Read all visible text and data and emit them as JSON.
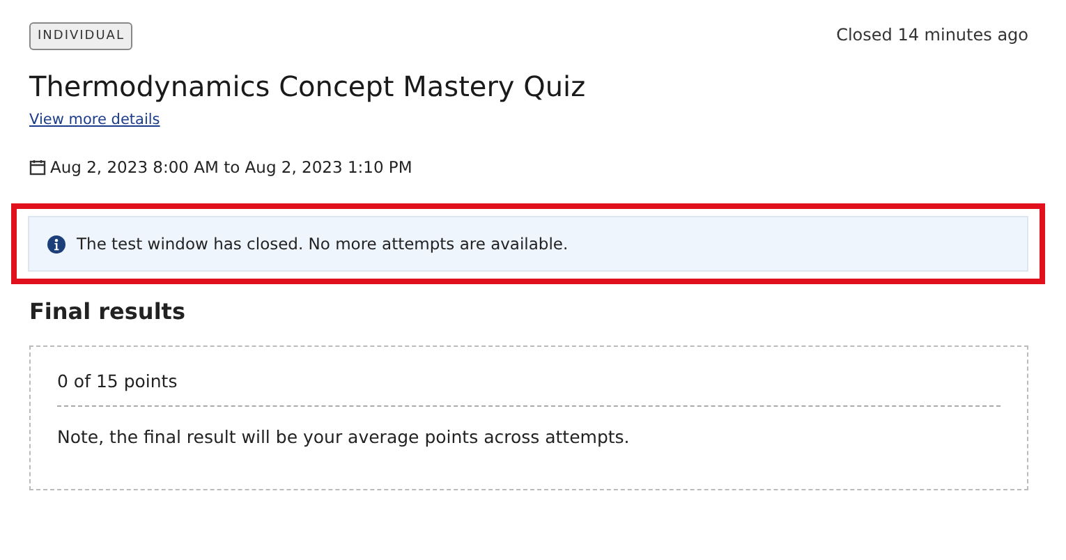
{
  "badge": "INDIVIDUAL",
  "status": "Closed 14 minutes ago",
  "title": "Thermodynamics Concept Mastery Quiz",
  "details_link": "View more details",
  "schedule": "Aug 2, 2023 8:00 AM to Aug 2, 2023 1:10 PM",
  "alert": {
    "text": "The test window has closed. No more attempts are available.",
    "highlighted": true
  },
  "results": {
    "heading": "Final results",
    "score": "0 of 15 points",
    "note": "Note, the final result will be your average points across attempts."
  }
}
